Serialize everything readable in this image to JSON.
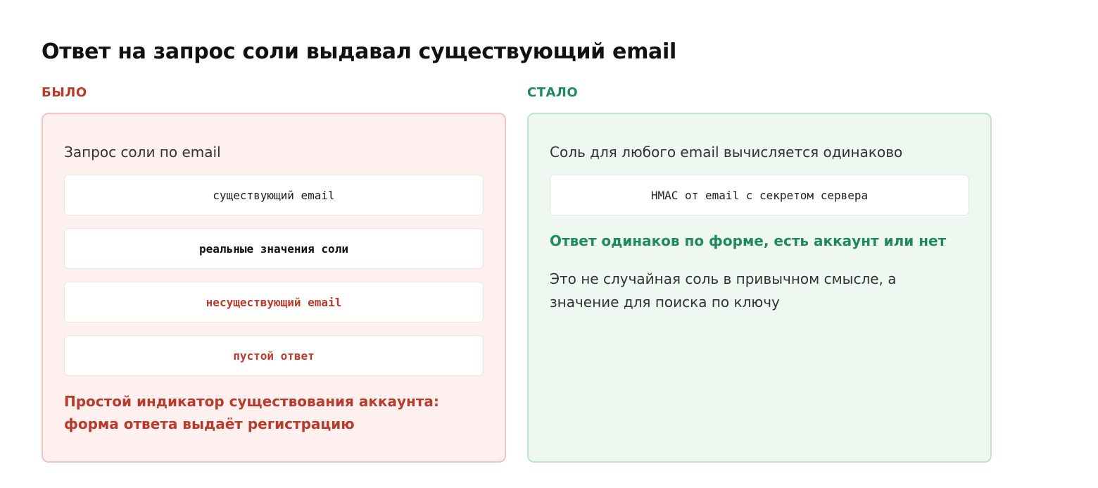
{
  "title": "Ответ на запрос соли выдавал существующий email",
  "before": {
    "label": "БЫЛО",
    "heading": "Запрос соли по email",
    "steps": [
      "существующий email",
      "реальные значения соли",
      "несуществующий email",
      "пустой ответ"
    ],
    "verdict": "Простой индикатор существования аккаунта: форма ответа выдаёт регистрацию",
    "accent_color": "#b83a2b"
  },
  "after": {
    "label": "СТАЛО",
    "heading": "Соль для любого email вычисляется одинаково",
    "steps": [
      "HMAC от email с секретом сервера"
    ],
    "verdict": "Ответ одинаков по форме, есть аккаунт или нет",
    "note": "Это не случайная соль в привычном смысле, а значение для поиска по ключу",
    "accent_color": "#1f8a5a"
  }
}
